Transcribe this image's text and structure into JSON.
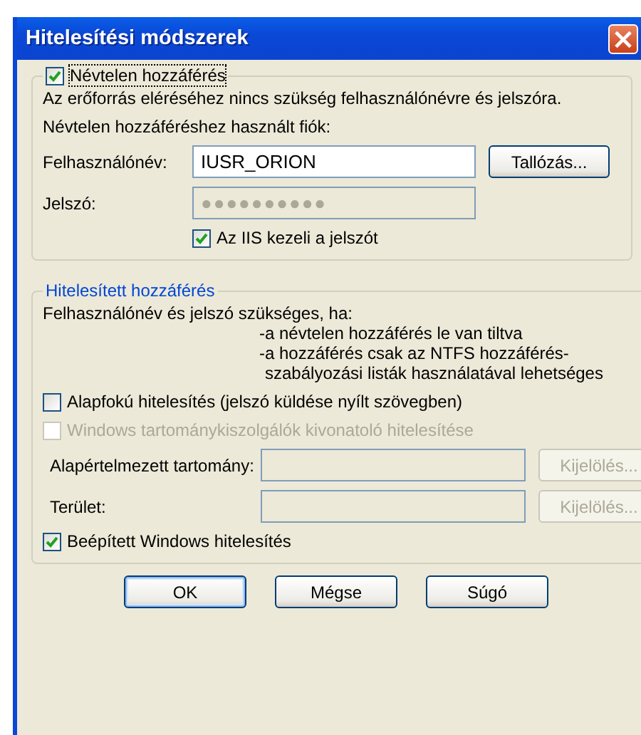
{
  "window": {
    "title": "Hitelesítési módszerek",
    "close_button": "×"
  },
  "anonymous": {
    "checkbox": {
      "label": "Névtelen hozzáférés",
      "checked": true,
      "disabled": false
    },
    "description": "Az erőforrás eléréséhez nincs szükség felhasználónévre és jelszóra.",
    "account_label": "Névtelen hozzáféréshez használt fiók:",
    "fields": [
      {
        "label": "Felhasználónév:",
        "value": "IUSR_ORION",
        "disabled": false,
        "button": {
          "label": "Tallózás...",
          "disabled": false
        }
      },
      {
        "label": "Jelszó:",
        "value": "●●●●●●●●●●",
        "disabled": true
      }
    ],
    "iis_checkbox": {
      "label": "Az IIS kezeli a jelszót",
      "checked": true,
      "disabled": false
    }
  },
  "authenticated": {
    "title": "Hitelesített hozzáférés",
    "intro": "Felhasználónév és jelszó szükséges, ha:",
    "conditions": [
      "-a névtelen hozzáférés le van tiltva",
      "-a hozzáférés csak az NTFS hozzáférés-szabályozási listák használatával lehetséges"
    ],
    "checkboxes": [
      {
        "label": "Alapfokú hitelesítés (jelszó küldése nyílt szövegben)",
        "checked": false,
        "disabled": false
      },
      {
        "label": "Windows tartománykiszolgálók kivonatoló hitelesítése",
        "checked": false,
        "disabled": true
      }
    ],
    "fields": [
      {
        "label": "Alapértelmezett tartomány:",
        "disabled": true,
        "button": {
          "label": "Kijelölés...",
          "disabled": true
        }
      },
      {
        "label": "Terület:",
        "disabled": true,
        "button": {
          "label": "Kijelölés...",
          "disabled": true
        }
      }
    ],
    "integrated": {
      "label": "Beépített Windows hitelesítés",
      "checked": true,
      "disabled": false
    }
  },
  "buttons": [
    {
      "label": "OK",
      "default": true
    },
    {
      "label": "Mégse",
      "default": false
    },
    {
      "label": "Súgó",
      "default": false
    }
  ]
}
